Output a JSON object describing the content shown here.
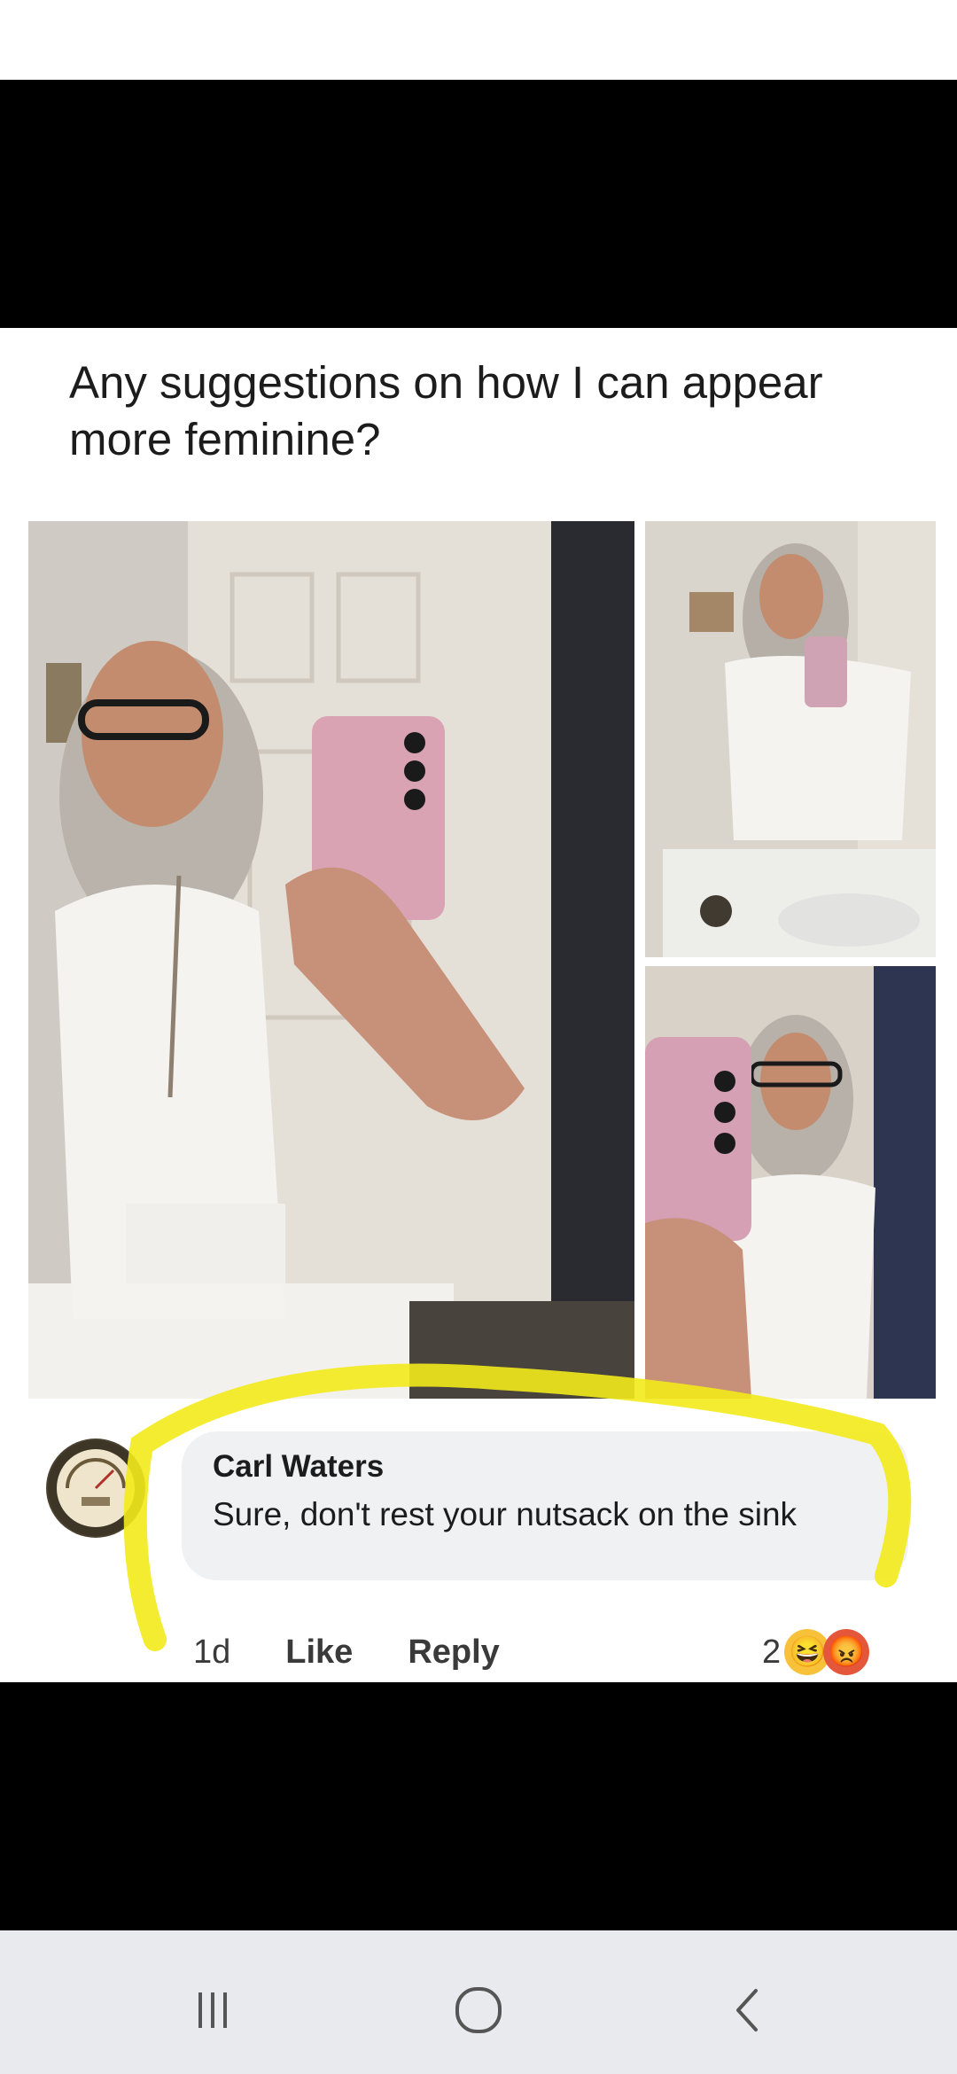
{
  "post": {
    "question": "Any suggestions on how I can appear more feminine?"
  },
  "comment": {
    "author": "Carl Waters",
    "text": "Sure, don't rest your nutsack on the sink",
    "time": "1d",
    "like_label": "Like",
    "reply_label": "Reply",
    "reaction_count": "2",
    "reactions": [
      "haha-emoji-icon",
      "angry-emoji-icon"
    ],
    "highlight_color": "#f2ea1a"
  },
  "navbar": {
    "buttons": [
      "recent-apps-icon",
      "home-icon",
      "back-icon"
    ]
  }
}
